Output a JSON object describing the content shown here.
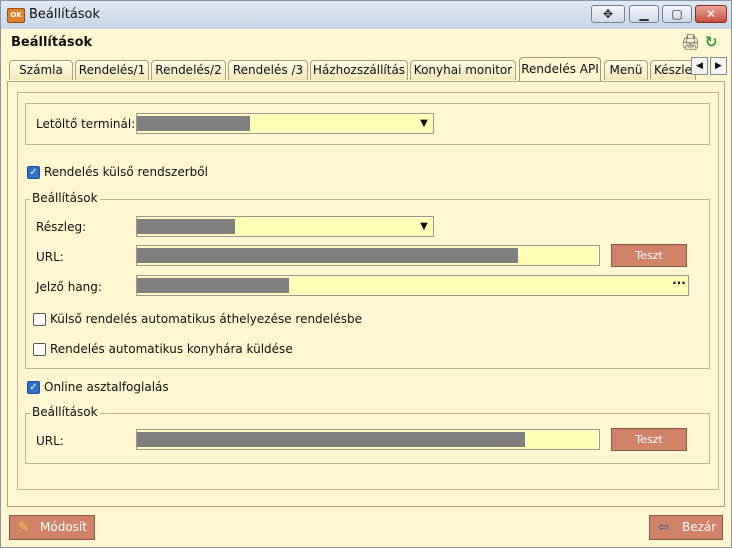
{
  "window": {
    "title": "Beállítások",
    "app_icon_text": "OK",
    "controls": {
      "move": "✥",
      "minimize": "▁",
      "maximize": "▢",
      "close": "✕"
    }
  },
  "header": {
    "title": "Beállítások",
    "printer_icon": "🖨",
    "refresh_icon": "↻"
  },
  "tabs": [
    {
      "label": "Számla"
    },
    {
      "label": "Rendelés/1"
    },
    {
      "label": "Rendelés/2"
    },
    {
      "label": "Rendelés /3"
    },
    {
      "label": "Házhozszállítás"
    },
    {
      "label": "Konyhai monitor"
    },
    {
      "label": "Rendelés API"
    },
    {
      "label": "Menü"
    },
    {
      "label": "Készle"
    }
  ],
  "active_tab": "Rendelés API",
  "tab_scroll": {
    "left": "◀",
    "right": "▶"
  },
  "form": {
    "terminal_label": "Letöltő terminál:",
    "external_checkbox_label": "Rendelés külső rendszerből",
    "external_checked": true,
    "settings1_legend": "Beállítások",
    "department_label": "Részleg:",
    "url_label": "URL:",
    "sound_label": "Jelző hang:",
    "test_button": "Teszt",
    "auto_move_label": "Külső rendelés automatikus áthelyezése rendelésbe",
    "auto_move_checked": false,
    "auto_kitchen_label": "Rendelés automatikus konyhára küldése",
    "auto_kitchen_checked": false,
    "online_checkbox_label": "Online asztalfoglalás",
    "online_checked": true,
    "settings2_legend": "Beállítások",
    "url2_label": "URL:",
    "test_button2": "Teszt",
    "ellipsis": "···",
    "dropdown_arrow": "▼",
    "check_mark": "✓"
  },
  "footer": {
    "modify_button": "Módosít",
    "modify_icon": "✎",
    "close_button": "Bezár",
    "close_icon": "⇦"
  },
  "colors": {
    "background": "#fff7d0",
    "field": "#ffffb8",
    "button": "#cf8266",
    "checkbox_checked": "#2f6fc7",
    "redacted": "#7f7f7f"
  }
}
